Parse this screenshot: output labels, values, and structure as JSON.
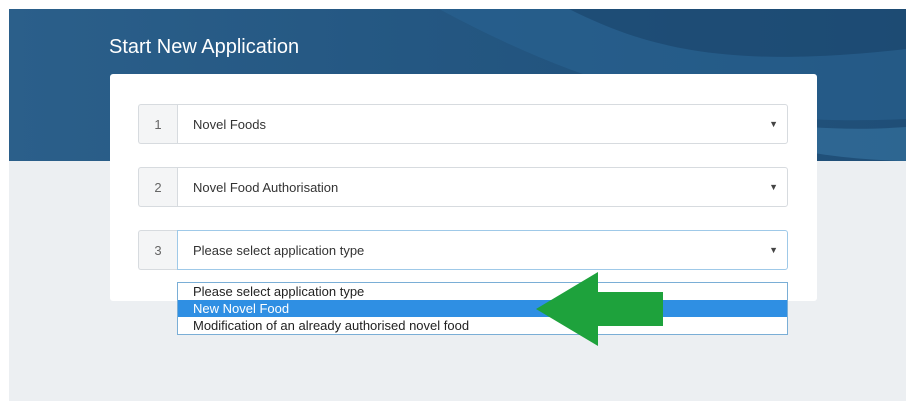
{
  "page": {
    "title": "Start New Application"
  },
  "steps": [
    {
      "number": "1",
      "value": "Novel Foods"
    },
    {
      "number": "2",
      "value": "Novel Food Authorisation"
    },
    {
      "number": "3",
      "value": "Please select application type"
    }
  ],
  "dropdown": {
    "options": [
      {
        "label": "Please select application type"
      },
      {
        "label": "New Novel Food",
        "selected": true
      },
      {
        "label": "Modification of an already authorised novel food"
      }
    ]
  },
  "colors": {
    "banner": "#245782",
    "selected_option": "#2f8fe3",
    "arrow": "#1ea23c"
  },
  "icons": {
    "caret": "caret-down-icon",
    "arrow": "pointer-arrow-icon"
  }
}
